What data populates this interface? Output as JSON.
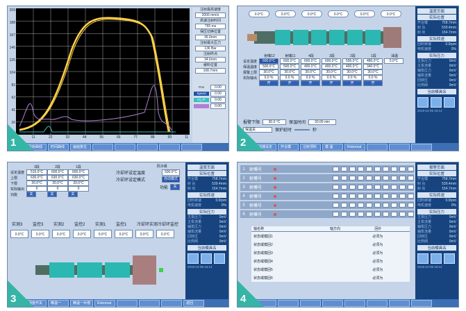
{
  "panel1": {
    "badge": "1",
    "y_ticks": [
      "209",
      "188",
      "167",
      "146",
      "125",
      "104",
      "83",
      "62",
      "41",
      "20",
      "0"
    ],
    "x_ticks": [
      "0",
      "11",
      "22",
      "33",
      "44",
      "55",
      "66",
      "77",
      "88",
      "99",
      "11"
    ],
    "side": {
      "max_inject_speed_label": "注射最高速度",
      "max_inject_speed_value": "2006",
      "max_inject_speed_unit": "mm/s",
      "hs_time_label": "高速注射时间",
      "hs_time_value": "765",
      "hs_time_unit": "ms",
      "hold_switch_label": "保压切换位置",
      "hold_switch_value": "36.0mm",
      "max_press_label": "注射最大压力",
      "max_press_value": "136",
      "max_press_unit": "Bar",
      "inj_end_label": "注射终点",
      "inj_end_value": "34.6mm",
      "cushion_label": "缓料位置",
      "cushion_value": "108.7mm",
      "legend": [
        {
          "name": "Pos",
          "value": "0.00"
        },
        {
          "name": "Speed",
          "value": "0.00"
        },
        {
          "name": "Inj_Pr",
          "value": "0.00"
        },
        {
          "name": "",
          "value": "0.00"
        }
      ]
    },
    "taskbar": [
      "注射曲线",
      "时间曲线",
      "画面复位",
      "",
      "",
      "",
      "",
      ""
    ]
  },
  "panel2": {
    "badge": "2",
    "zones_top": [
      "0.0°C",
      "0.0°C",
      "0.0°C",
      "0.0°C",
      "0.0°C",
      "0.0°C"
    ],
    "col_headers": [
      "射嘴12",
      "射嘴11",
      "4段",
      "3段",
      "2段",
      "1段",
      "油温"
    ],
    "rows": [
      {
        "label": "设定温度",
        "values": [
          "600.0°C",
          "600.0°C",
          "600.0°C",
          "600.0°C",
          "595.0°C",
          "480.0°C",
          "0.0°C"
        ]
      },
      {
        "label": "保温温度",
        "values": [
          "500.0°C",
          "500.0°C",
          "400.0°C",
          "400.0°C",
          "400.0°C",
          "340.0°C",
          ""
        ]
      },
      {
        "label": "报警上限",
        "values": [
          "30.0°C",
          "30.0°C",
          "30.0°C",
          "30.0°C",
          "30.0°C",
          "30.0°C",
          ""
        ]
      },
      {
        "label": "实际输出",
        "values": [
          "0.0 %",
          "0.0 %",
          "0.0 %",
          "0.0 %",
          "0.0 %",
          "0.0 %",
          ""
        ]
      }
    ],
    "switch_label": "开",
    "alarm_low_label": "报警下限",
    "alarm_low_value": "30.0 °C",
    "hold_time_label": "保温时间",
    "hold_time_value": "30.00 min",
    "hold_mode_value": "保温关",
    "protect_label": "保护延时",
    "protect_unit": "秒",
    "taskbar": [
      "快捷设定",
      "开合模",
      "注射顶料",
      "模 温",
      "Robomat",
      "",
      "",
      ""
    ]
  },
  "panel3": {
    "badge": "3",
    "col_headers": [
      "3段",
      "2段",
      "1段"
    ],
    "rows": [
      {
        "label": "设定温度",
        "values": [
          "515.0°C",
          "600.0°C",
          "600.0°C"
        ]
      },
      {
        "label": "上限",
        "values": [
          "630.0°C",
          "630.0°C",
          "630.0°C"
        ]
      },
      {
        "label": "下限",
        "values": [
          "20.0°C",
          "20.0°C",
          "20.0°C"
        ]
      },
      {
        "label": "实际输出",
        "values": [
          "0",
          "0",
          "0"
        ]
      },
      {
        "label": "功能",
        "values": [
          "关",
          "关",
          "关"
        ]
      }
    ],
    "air_title": "风冷阀",
    "cool_set_label": "冷却环设定温度",
    "cool_set_value": "500.0°C",
    "cool_mode_label": "冷却环设定模式",
    "cool_mode_value": "自动模式",
    "func_label": "功能",
    "func_value": "关",
    "probes": [
      "实测3",
      "监控3",
      "实测2",
      "监控2",
      "实测1",
      "监控1",
      "冷却环实测",
      "冷却环监控"
    ],
    "probe_values": [
      "0.0°C",
      "0.0°C",
      "0.0°C",
      "0.0°C",
      "0.0°C",
      "0.0°C",
      "0.0°C",
      "0.0°C"
    ],
    "taskbar": [
      "温度开关",
      "精温一",
      "精温一补偿",
      "Robomat",
      "",
      "",
      "",
      "返回"
    ]
  },
  "panel4": {
    "badge": "4",
    "nozzles": [
      "射嘴号",
      "射嘴号",
      "射嘴号",
      "射嘴号",
      "射嘴号",
      "射嘴号"
    ],
    "table_headers": [
      "轴名称",
      "轴方向",
      "回针"
    ],
    "table_rows": [
      {
        "name": "状态或模回1",
        "dir": "",
        "act": "必须为"
      },
      {
        "name": "状态或模回2",
        "dir": "",
        "act": "必须为"
      },
      {
        "name": "状态或模回3",
        "dir": "",
        "act": "必须为"
      },
      {
        "name": "状态或模回4",
        "dir": "",
        "act": "必须为"
      },
      {
        "name": "状态或模回5",
        "dir": "",
        "act": "必须为"
      },
      {
        "name": "状态或模回6",
        "dir": "",
        "act": "必须为"
      }
    ],
    "top_title": "报警页面",
    "taskbar": [
      "",
      "",
      "",
      "",
      "",
      "",
      "",
      ""
    ]
  },
  "right_panel": {
    "title_temp": "温度页面",
    "title_pos": "实际位置",
    "rows_pos": [
      {
        "label": "开合模",
        "value": "758.7mm"
      },
      {
        "label": "射 台",
        "value": "539.4mm"
      },
      {
        "label": "射 出",
        "value": "154.7mm"
      }
    ],
    "title_speed": "实际转速",
    "rows_speed": [
      {
        "label": "回料转速",
        "value": "0.0rpm"
      },
      {
        "label": "电机速度",
        "value": "0%"
      }
    ],
    "title_press": "实际压力",
    "rows_press": [
      {
        "label": "主泵压力",
        "value": "0mV"
      },
      {
        "label": "主泵流量",
        "value": "0mV"
      },
      {
        "label": "辅泵压力",
        "value": "0mV"
      },
      {
        "label": "辅泵流量",
        "value": "0mV"
      },
      {
        "label": "回转压",
        "value": "0mV"
      },
      {
        "label": "比例阀",
        "value": "0mV"
      }
    ],
    "mold_title": "当前模具名",
    "date": "2019-12-09 16:14"
  },
  "colors": {
    "chart_bg": "#000000",
    "grid": "#d9d9d9",
    "yellow_curve": "#ffd24a",
    "purple_curve": "#b07fd6",
    "teal_curve": "#35c2c0",
    "accent": "#35b5a6",
    "taskbar": "#3d6fb5",
    "right_panel": "#17447e"
  }
}
